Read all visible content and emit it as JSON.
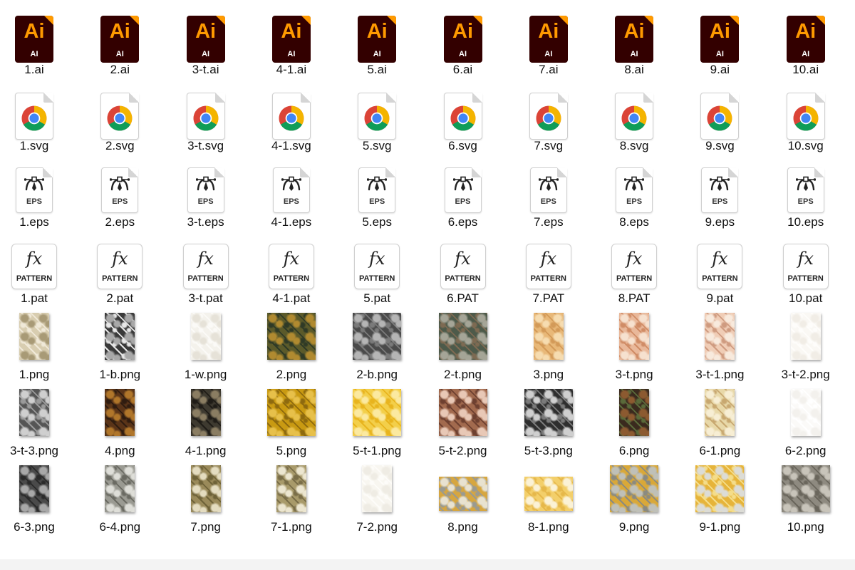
{
  "colors": {
    "ai_bg": "#330000",
    "ai_orange": "#ff9a00",
    "chrome_red": "#db4437",
    "chrome_yellow": "#f4b400",
    "chrome_green": "#0f9d58",
    "chrome_blue": "#4285f4"
  },
  "icons": {
    "ai": "adobe-illustrator-icon",
    "svg": "chrome-svg-icon",
    "eps": "eps-pen-icon",
    "pat": "fx-pattern-icon",
    "png": "image-thumbnail"
  },
  "badges": {
    "ai_big": "Ai",
    "ai_small": "AI",
    "eps": "EPS",
    "pat_fx": "fx",
    "pat": "PATTERN"
  },
  "files": [
    {
      "name": "1.ai",
      "kind": "ai"
    },
    {
      "name": "2.ai",
      "kind": "ai"
    },
    {
      "name": "3-t.ai",
      "kind": "ai"
    },
    {
      "name": "4-1.ai",
      "kind": "ai"
    },
    {
      "name": "5.ai",
      "kind": "ai"
    },
    {
      "name": "6.ai",
      "kind": "ai"
    },
    {
      "name": "7.ai",
      "kind": "ai"
    },
    {
      "name": "8.ai",
      "kind": "ai"
    },
    {
      "name": "9.ai",
      "kind": "ai"
    },
    {
      "name": "10.ai",
      "kind": "ai"
    },
    {
      "name": "1.svg",
      "kind": "svg"
    },
    {
      "name": "2.svg",
      "kind": "svg"
    },
    {
      "name": "3-t.svg",
      "kind": "svg"
    },
    {
      "name": "4-1.svg",
      "kind": "svg"
    },
    {
      "name": "5.svg",
      "kind": "svg"
    },
    {
      "name": "6.svg",
      "kind": "svg"
    },
    {
      "name": "7.svg",
      "kind": "svg"
    },
    {
      "name": "8.svg",
      "kind": "svg"
    },
    {
      "name": "9.svg",
      "kind": "svg"
    },
    {
      "name": "10.svg",
      "kind": "svg"
    },
    {
      "name": "1.eps",
      "kind": "eps"
    },
    {
      "name": "2.eps",
      "kind": "eps"
    },
    {
      "name": "3-t.eps",
      "kind": "eps"
    },
    {
      "name": "4-1.eps",
      "kind": "eps"
    },
    {
      "name": "5.eps",
      "kind": "eps"
    },
    {
      "name": "6.eps",
      "kind": "eps"
    },
    {
      "name": "7.eps",
      "kind": "eps"
    },
    {
      "name": "8.eps",
      "kind": "eps"
    },
    {
      "name": "9.eps",
      "kind": "eps"
    },
    {
      "name": "10.eps",
      "kind": "eps"
    },
    {
      "name": "1.pat",
      "kind": "pat"
    },
    {
      "name": "2.pat",
      "kind": "pat"
    },
    {
      "name": "3-t.pat",
      "kind": "pat"
    },
    {
      "name": "4-1.pat",
      "kind": "pat"
    },
    {
      "name": "5.pat",
      "kind": "pat"
    },
    {
      "name": "6.PAT",
      "kind": "pat"
    },
    {
      "name": "7.PAT",
      "kind": "pat"
    },
    {
      "name": "8.PAT",
      "kind": "pat"
    },
    {
      "name": "9.pat",
      "kind": "pat"
    },
    {
      "name": "10.pat",
      "kind": "pat"
    },
    {
      "name": "1.png",
      "kind": "png",
      "shape": "tall",
      "colors": [
        "#d8cdb0",
        "#a89a76",
        "#f0e9d8"
      ]
    },
    {
      "name": "1-b.png",
      "kind": "png",
      "shape": "tall",
      "colors": [
        "#3a3a3a",
        "#a8a8a8",
        "#e8e8e8"
      ]
    },
    {
      "name": "1-w.png",
      "kind": "png",
      "shape": "tall",
      "colors": [
        "#f4f2ec",
        "#e6e2d8",
        "#fbfaf7"
      ]
    },
    {
      "name": "2.png",
      "kind": "png",
      "shape": "square",
      "colors": [
        "#5b5a2a",
        "#b08a30",
        "#2f3a26"
      ]
    },
    {
      "name": "2-b.png",
      "kind": "png",
      "shape": "square",
      "colors": [
        "#4a4a4a",
        "#b5b5b5",
        "#7a7a7a"
      ]
    },
    {
      "name": "2-t.png",
      "kind": "png",
      "shape": "square",
      "colors": [
        "#4d5a4a",
        "#a5a597",
        "#7d6a52"
      ]
    },
    {
      "name": "3.png",
      "kind": "png",
      "shape": "tall",
      "colors": [
        "#e8b878",
        "#f6dcb0",
        "#d39a58"
      ]
    },
    {
      "name": "3-t.png",
      "kind": "png",
      "shape": "tall",
      "colors": [
        "#e9b89a",
        "#f6e1cf",
        "#d08c66"
      ]
    },
    {
      "name": "3-t-1.png",
      "kind": "png",
      "shape": "tall",
      "colors": [
        "#f0cdb6",
        "#f8eadd",
        "#cf9b80"
      ]
    },
    {
      "name": "3-t-2.png",
      "kind": "png",
      "shape": "tall",
      "colors": [
        "#faf8f4",
        "#f1ede6",
        "#fefdfb"
      ]
    },
    {
      "name": "3-t-3.png",
      "kind": "png",
      "shape": "tall",
      "colors": [
        "#555555",
        "#cfcfcf",
        "#9a9a9a"
      ]
    },
    {
      "name": "4.png",
      "kind": "png",
      "shape": "tall",
      "colors": [
        "#5a3418",
        "#b0762a",
        "#2f1c10"
      ]
    },
    {
      "name": "4-1.png",
      "kind": "png",
      "shape": "tall",
      "colors": [
        "#3e3a30",
        "#8a7d62",
        "#1f1c17"
      ]
    },
    {
      "name": "5.png",
      "kind": "png",
      "shape": "square",
      "colors": [
        "#c99a12",
        "#e7c04a",
        "#8e6a0e"
      ]
    },
    {
      "name": "5-t-1.png",
      "kind": "png",
      "shape": "square",
      "colors": [
        "#f3cf4a",
        "#fbe9a0",
        "#e8b41e"
      ]
    },
    {
      "name": "5-t-2.png",
      "kind": "png",
      "shape": "square",
      "colors": [
        "#a26a4e",
        "#e8c8b6",
        "#6e4030"
      ]
    },
    {
      "name": "5-t-3.png",
      "kind": "png",
      "shape": "square",
      "colors": [
        "#2e2e2e",
        "#cfcfcf",
        "#7a7a7a"
      ]
    },
    {
      "name": "6.png",
      "kind": "png",
      "shape": "tall",
      "colors": [
        "#3a2a1e",
        "#8c5a30",
        "#5a6a3a"
      ]
    },
    {
      "name": "6-1.png",
      "kind": "png",
      "shape": "tall",
      "colors": [
        "#e8d8a8",
        "#f7eed4",
        "#c8a870"
      ]
    },
    {
      "name": "6-2.png",
      "kind": "png",
      "shape": "tall",
      "colors": [
        "#fbfaf8",
        "#f3f1ed",
        "#ffffff"
      ]
    },
    {
      "name": "6-3.png",
      "kind": "png",
      "shape": "tall",
      "colors": [
        "#4a4a4a",
        "#a8a8a8",
        "#2a2a2a"
      ]
    },
    {
      "name": "6-4.png",
      "kind": "png",
      "shape": "tall",
      "colors": [
        "#9a9a92",
        "#deded8",
        "#6a6a62"
      ]
    },
    {
      "name": "7.png",
      "kind": "png",
      "shape": "tall",
      "colors": [
        "#9a8a5a",
        "#e4dcc0",
        "#6e6238"
      ]
    },
    {
      "name": "7-1.png",
      "kind": "png",
      "shape": "tall",
      "colors": [
        "#a89a6a",
        "#ece6d0",
        "#7a6e48"
      ]
    },
    {
      "name": "7-2.png",
      "kind": "png",
      "shape": "tall",
      "colors": [
        "#f8f6f0",
        "#efece4",
        "#fdfcf9"
      ]
    },
    {
      "name": "8.png",
      "kind": "png",
      "shape": "wide",
      "colors": [
        "#d6a640",
        "#e8e2d0",
        "#9a9a90"
      ]
    },
    {
      "name": "8-1.png",
      "kind": "png",
      "shape": "wide",
      "colors": [
        "#f3cf6a",
        "#fbf2d6",
        "#e6b84a"
      ]
    },
    {
      "name": "9.png",
      "kind": "png",
      "shape": "square",
      "colors": [
        "#d9a838",
        "#bfc0b8",
        "#8a8a80"
      ]
    },
    {
      "name": "9-1.png",
      "kind": "png",
      "shape": "square",
      "colors": [
        "#e6b43a",
        "#dcdcd6",
        "#f4dd8a"
      ]
    },
    {
      "name": "10.png",
      "kind": "png",
      "shape": "square",
      "colors": [
        "#8e8a80",
        "#c8c4ba",
        "#6a665c"
      ]
    }
  ]
}
